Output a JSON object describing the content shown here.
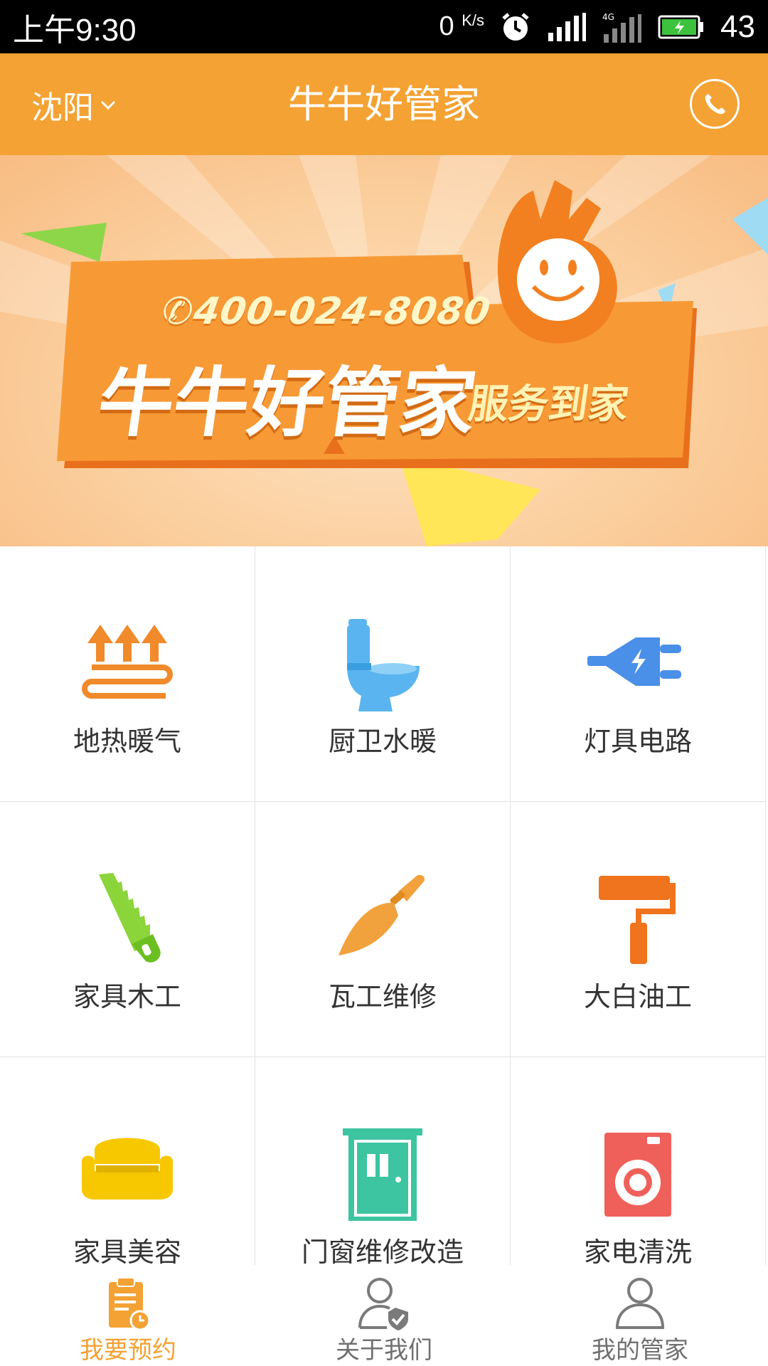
{
  "status_bar": {
    "time": "上午9:30",
    "net_speed": "0",
    "net_unit": "K/s",
    "network": "4G",
    "battery": "43"
  },
  "header": {
    "city": "沈阳",
    "title": "牛牛好管家",
    "phone_icon": "phone-icon"
  },
  "banner": {
    "phone": "400-024-8080",
    "title": "牛牛好管家",
    "subtitle": "服务到家"
  },
  "services": [
    {
      "label": "地热暖气",
      "icon": "floor-heating-icon",
      "color": "#f08a2a"
    },
    {
      "label": "厨卫水暖",
      "icon": "toilet-icon",
      "color": "#5ab4f0"
    },
    {
      "label": "灯具电路",
      "icon": "plug-icon",
      "color": "#4a8fe8"
    },
    {
      "label": "家具木工",
      "icon": "saw-icon",
      "color": "#8bd43a"
    },
    {
      "label": "瓦工维修",
      "icon": "trowel-icon",
      "color": "#f2a23c"
    },
    {
      "label": "大白油工",
      "icon": "paint-roller-icon",
      "color": "#f0731e"
    },
    {
      "label": "家具美容",
      "icon": "sofa-icon",
      "color": "#f7c800"
    },
    {
      "label": "门窗维修改造",
      "icon": "door-icon",
      "color": "#3dc4a0"
    },
    {
      "label": "家电清洗",
      "icon": "washing-machine-icon",
      "color": "#f0605a"
    }
  ],
  "bottom_nav": [
    {
      "label": "我要预约",
      "icon": "appointment-icon",
      "active": true
    },
    {
      "label": "关于我们",
      "icon": "about-us-icon",
      "active": false
    },
    {
      "label": "我的管家",
      "icon": "my-butler-icon",
      "active": false
    }
  ],
  "colors": {
    "brand": "#f4a233",
    "nav_inactive": "#707070"
  }
}
